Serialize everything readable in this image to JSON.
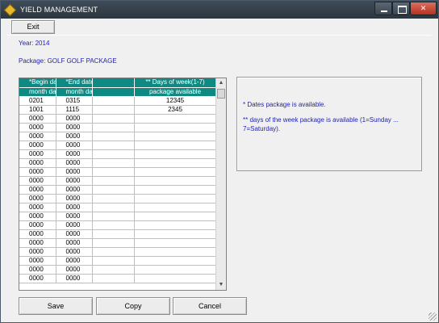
{
  "window": {
    "title": "YIELD MANAGEMENT",
    "minimize": "",
    "maximize": "",
    "close": "✕"
  },
  "toolbar": {
    "exit_label": "Exit"
  },
  "info": {
    "year": "Year: 2014",
    "package": "Package: GOLF GOLF PACKAGE"
  },
  "grid": {
    "header1": [
      "*Begin date",
      "*End date",
      "",
      "** Days of week(1-7)"
    ],
    "header2": [
      "month day",
      "month day",
      "",
      "package available"
    ],
    "rows": [
      [
        "0201",
        "0315",
        "",
        "12345"
      ],
      [
        "1001",
        "1115",
        "",
        "2345"
      ],
      [
        "0000",
        "0000",
        "",
        ""
      ],
      [
        "0000",
        "0000",
        "",
        ""
      ],
      [
        "0000",
        "0000",
        "",
        ""
      ],
      [
        "0000",
        "0000",
        "",
        ""
      ],
      [
        "0000",
        "0000",
        "",
        ""
      ],
      [
        "0000",
        "0000",
        "",
        ""
      ],
      [
        "0000",
        "0000",
        "",
        ""
      ],
      [
        "0000",
        "0000",
        "",
        ""
      ],
      [
        "0000",
        "0000",
        "",
        ""
      ],
      [
        "0000",
        "0000",
        "",
        ""
      ],
      [
        "0000",
        "0000",
        "",
        ""
      ],
      [
        "0000",
        "0000",
        "",
        ""
      ],
      [
        "0000",
        "0000",
        "",
        ""
      ],
      [
        "0000",
        "0000",
        "",
        ""
      ],
      [
        "0000",
        "0000",
        "",
        ""
      ],
      [
        "0000",
        "0000",
        "",
        ""
      ],
      [
        "0000",
        "0000",
        "",
        ""
      ],
      [
        "0000",
        "0000",
        "",
        ""
      ],
      [
        "0000",
        "0000",
        "",
        ""
      ]
    ],
    "scroll_up": "▲",
    "scroll_down": "▼"
  },
  "notes": {
    "line1": "* Dates package is available.",
    "line2": "** days of the week package is available (1=Sunday ... 7=Saturday)."
  },
  "buttons": {
    "save": "Save",
    "copy": "Copy",
    "cancel": "Cancel"
  },
  "colors": {
    "header_bg": "#0f8a83",
    "label_text": "#1f1fae"
  }
}
